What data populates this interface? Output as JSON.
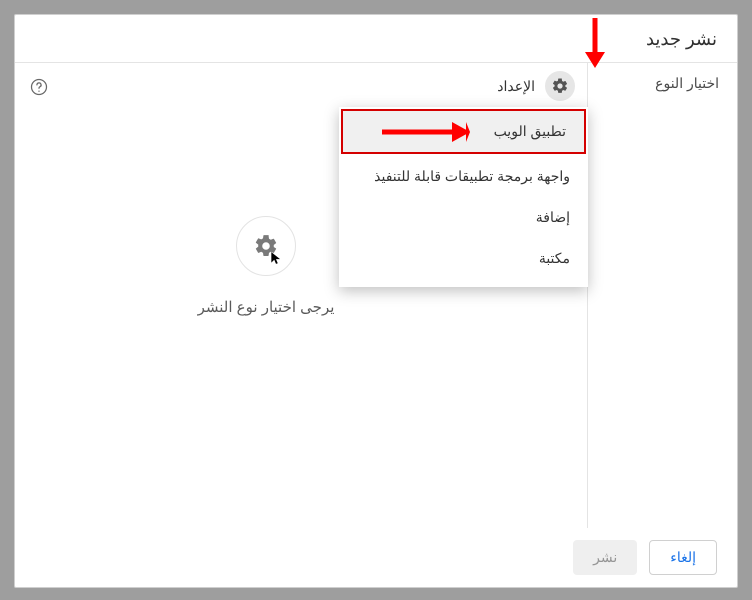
{
  "dialog": {
    "title": "نشر جديد"
  },
  "sidebar": {
    "select_type_label": "اختيار النوع"
  },
  "toolbar": {
    "config_label": "الإعداد"
  },
  "dropdown": {
    "items": [
      {
        "label": "تطبيق الويب",
        "highlighted": true
      },
      {
        "label": "واجهة برمجة تطبيقات قابلة للتنفيذ",
        "highlighted": false
      },
      {
        "label": "إضافة",
        "highlighted": false
      },
      {
        "label": "مكتبة",
        "highlighted": false
      }
    ]
  },
  "center": {
    "prompt": "يرجى اختيار نوع النشر"
  },
  "footer": {
    "publish_label": "نشر",
    "cancel_label": "إلغاء"
  },
  "annotations": {
    "arrow_color": "#ff0000"
  }
}
